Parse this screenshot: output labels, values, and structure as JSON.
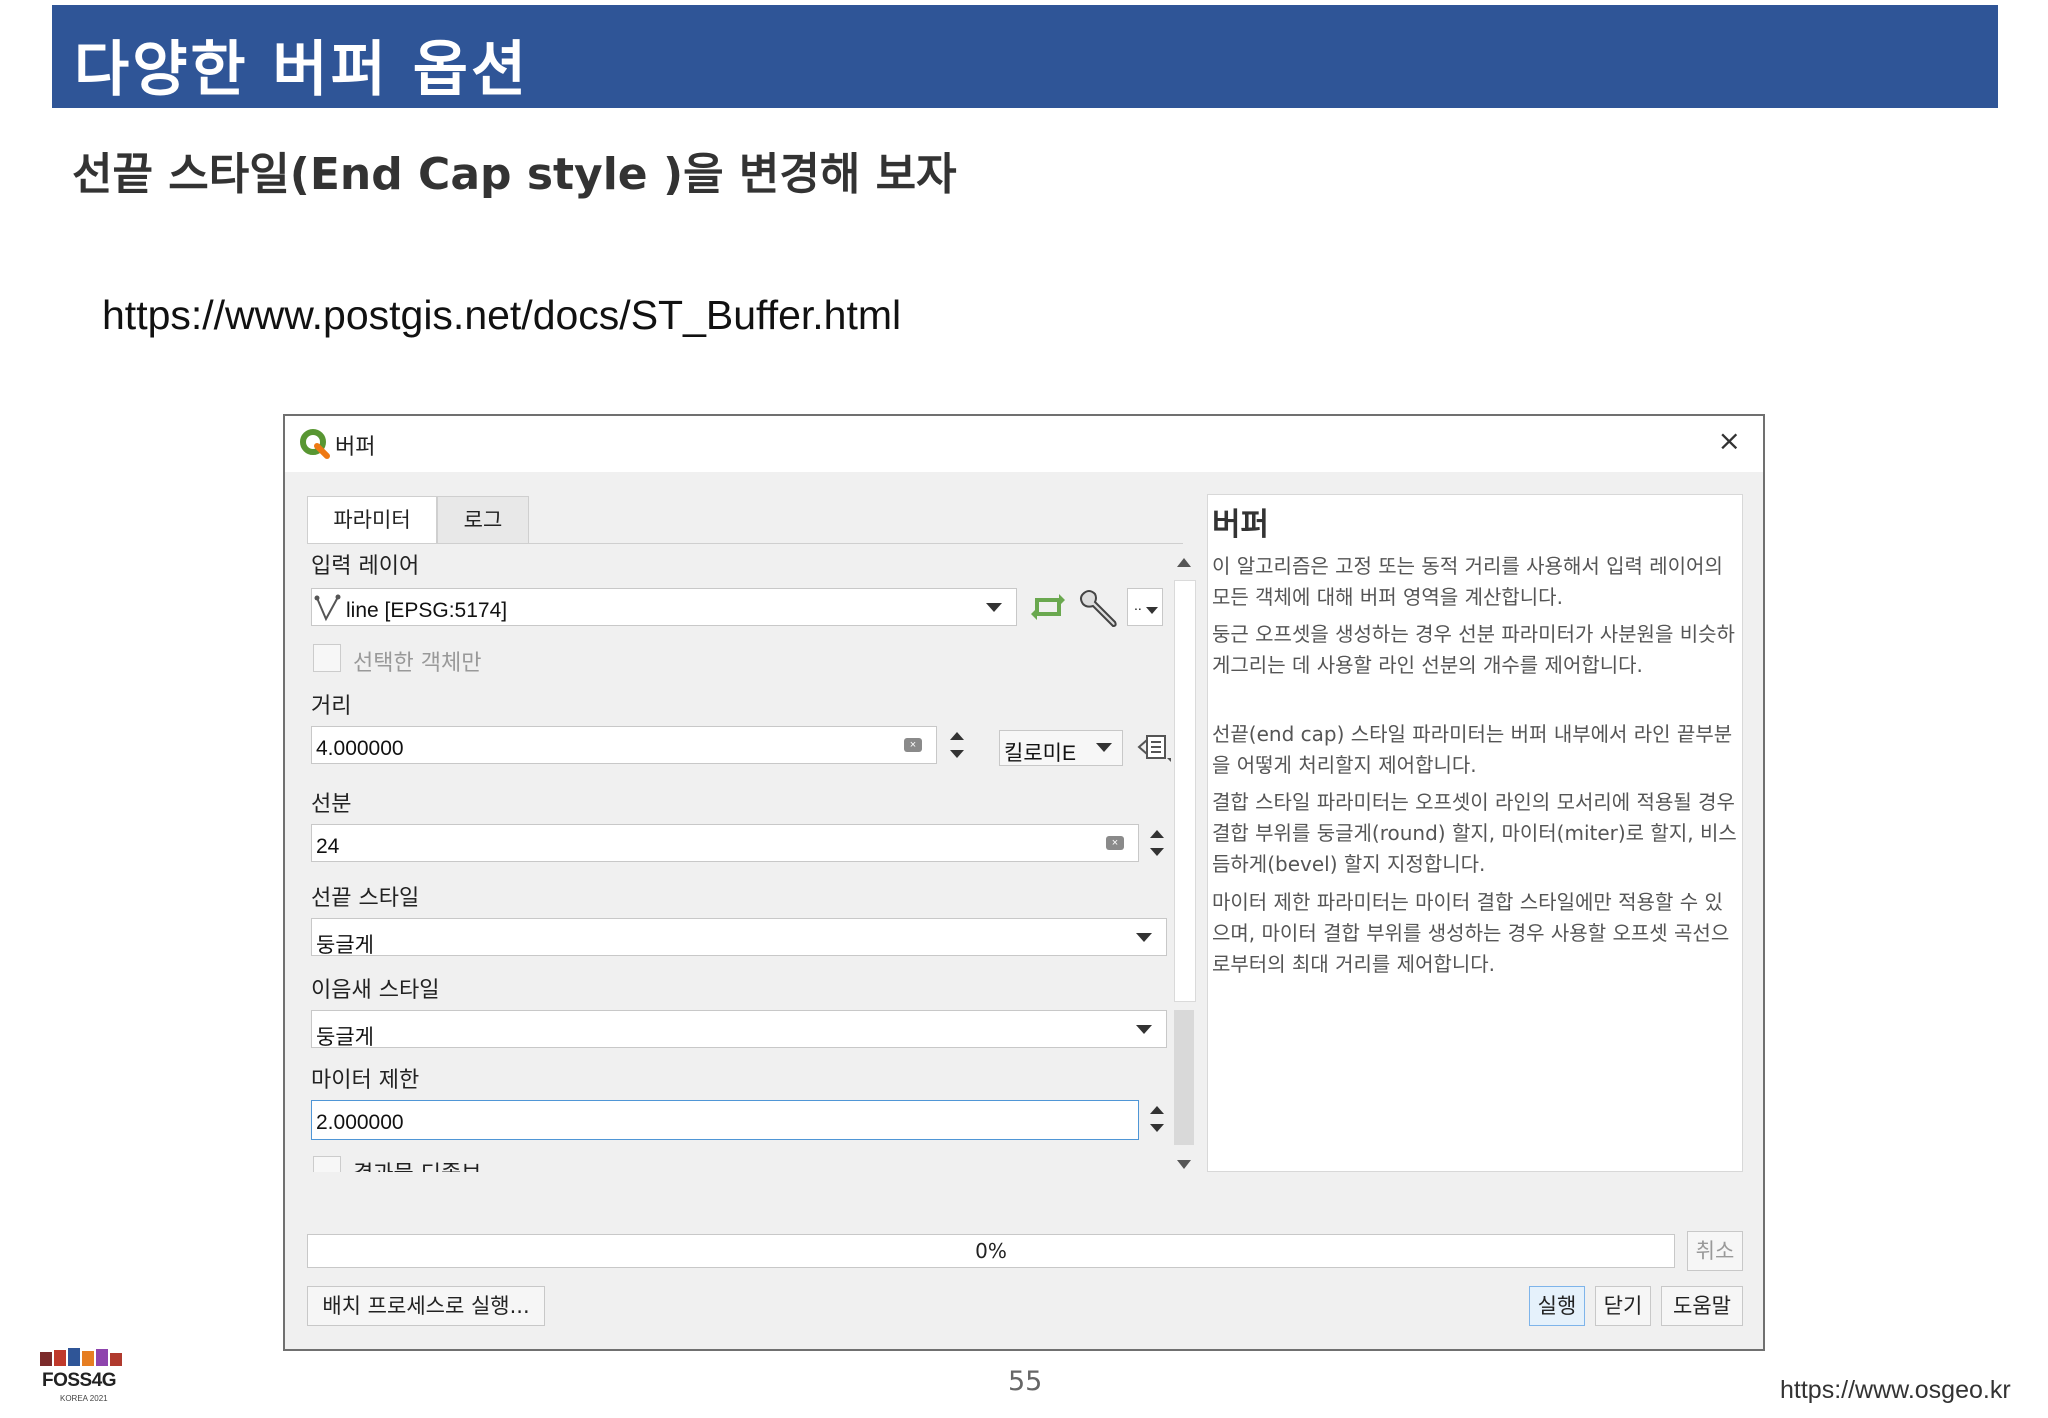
{
  "slide": {
    "title": "다양한 버퍼 옵션",
    "subtitle": "선끝 스타일(End Cap style )을 변경해 보자",
    "reference_url": "https://www.postgis.net/docs/ST_Buffer.html",
    "page_number": "55",
    "footer_url": "https://www.osgeo.kr",
    "logo_text": "FOSS4G",
    "logo_subtext": "KOREA 2021"
  },
  "dialog": {
    "title": "버퍼",
    "close_glyph": "×",
    "tabs": [
      {
        "label": "파라미터",
        "active": true
      },
      {
        "label": "로그",
        "active": false
      }
    ],
    "params": {
      "input_layer_label": "입력 레이어",
      "input_layer_value": "line [EPSG:5174]",
      "selected_only_label": "선택한 객체만",
      "distance_label": "거리",
      "distance_value": "4.000000",
      "distance_unit": "킬로미E",
      "segments_label": "선분",
      "segments_value": "24",
      "end_cap_label": "선끝 스타일",
      "end_cap_value": "둥글게",
      "join_label": "이음새 스타일",
      "join_value": "둥글게",
      "miter_label": "마이터 제한",
      "miter_value": "2.000000",
      "dissolve_label": "결과물 디졸브"
    },
    "help": {
      "title": "버퍼",
      "paragraphs": [
        "이 알고리즘은 고정 또는 동적 거리를 사용해서 입력 레이어의 모든 객체에 대해 버퍼 영역을 계산합니다.",
        "둥근 오프셋을 생성하는 경우 선분 파라미터가 사분원을 비슷하게그리는 데 사용할 라인 선분의 개수를 제어합니다.",
        "선끝(end cap) 스타일 파라미터는 버퍼 내부에서 라인 끝부분을 어떻게 처리할지 제어합니다.",
        "결합 스타일 파라미터는 오프셋이 라인의 모서리에 적용될 경우 결합 부위를 둥글게(round) 할지, 마이터(miter)로 할지, 비스듬하게(bevel) 할지 지정합니다.",
        "마이터 제한 파라미터는 마이터 결합 스타일에만 적용할 수 있으며, 마이터 결합 부위를 생성하는 경우 사용할 오프셋 곡선으로부터의 최대 거리를 제어합니다."
      ]
    },
    "progress": {
      "text": "0%",
      "value": 0
    },
    "buttons": {
      "cancel": "취소",
      "batch": "배치 프로세스로 실행...",
      "run": "실행",
      "close": "닫기",
      "help": "도움말"
    },
    "colors": {
      "accent": "#2f5597",
      "primary_button_border": "#7eb4ea",
      "qgis_green": "#589632"
    }
  }
}
